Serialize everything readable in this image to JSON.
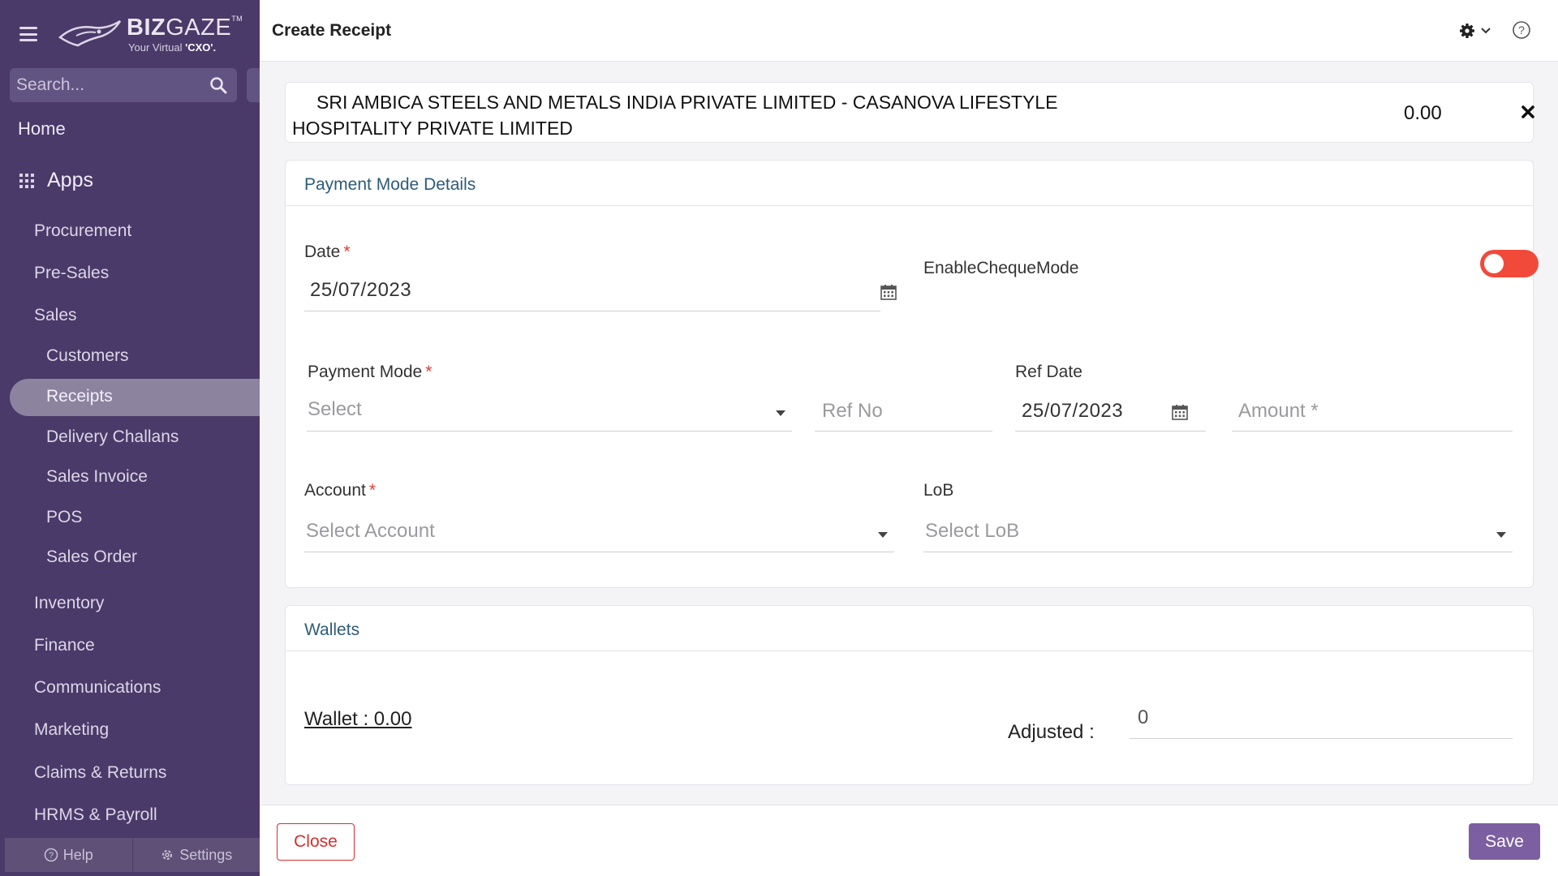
{
  "sidebar": {
    "brand": {
      "name_bold": "BIZ",
      "name_light": "GAZE",
      "trademark": "TM",
      "tagline_prefix": "Your Virtual ",
      "tagline_bold": "'CXO'."
    },
    "search_placeholder": "Search...",
    "home": "Home",
    "apps_label": "Apps",
    "items": [
      {
        "label": "Procurement",
        "level": "top"
      },
      {
        "label": "Pre-Sales",
        "level": "top"
      },
      {
        "label": "Sales",
        "level": "top"
      },
      {
        "label": "Customers",
        "level": "sub"
      },
      {
        "label": "Receipts",
        "level": "sub",
        "active": true
      },
      {
        "label": "Delivery Challans",
        "level": "sub"
      },
      {
        "label": "Sales Invoice",
        "level": "sub"
      },
      {
        "label": "POS",
        "level": "sub"
      },
      {
        "label": "Sales Order",
        "level": "sub"
      },
      {
        "label": "Inventory",
        "level": "top"
      },
      {
        "label": "Finance",
        "level": "top"
      },
      {
        "label": "Communications",
        "level": "top"
      },
      {
        "label": "Marketing",
        "level": "top"
      },
      {
        "label": "Claims & Returns",
        "level": "top"
      },
      {
        "label": "HRMS & Payroll",
        "level": "top"
      }
    ],
    "footer": {
      "help": "Help",
      "settings": "Settings"
    }
  },
  "header": {
    "title": "Create Receipt",
    "icons": [
      "gear-icon",
      "chevron-down-icon",
      "help-circle-icon"
    ]
  },
  "customer": {
    "name": "SRI AMBICA STEELS AND METALS INDIA PRIVATE LIMITED - CASANOVA LIFESTYLE HOSPITALITY PRIVATE LIMITED",
    "amount": "0.00"
  },
  "payment_mode_section": {
    "title": "Payment Mode Details",
    "date": {
      "label": "Date",
      "value": "25/07/2023"
    },
    "enable_cheque": {
      "label": "EnableChequeMode",
      "on": false
    },
    "payment_mode": {
      "label": "Payment Mode",
      "placeholder": "Select"
    },
    "ref_no": {
      "placeholder": "Ref No"
    },
    "ref_date": {
      "label": "Ref Date",
      "value": "25/07/2023"
    },
    "amount": {
      "placeholder": "Amount *"
    },
    "account": {
      "label": "Account",
      "placeholder": "Select Account"
    },
    "lob": {
      "label": "LoB",
      "placeholder": "Select LoB"
    }
  },
  "wallets_section": {
    "title": "Wallets",
    "wallet_link": "Wallet : 0.00",
    "adjusted_label": "Adjusted :",
    "adjusted_value": "0"
  },
  "actions": {
    "close": "Close",
    "save": "Save"
  },
  "colors": {
    "sidebar_bg": "#4a3a69",
    "active_item": "#8c839f",
    "accent": "#7c5fa0",
    "danger": "#d32f2f",
    "toggle_off": "#f24a3a",
    "section_title": "#2e5b78"
  }
}
